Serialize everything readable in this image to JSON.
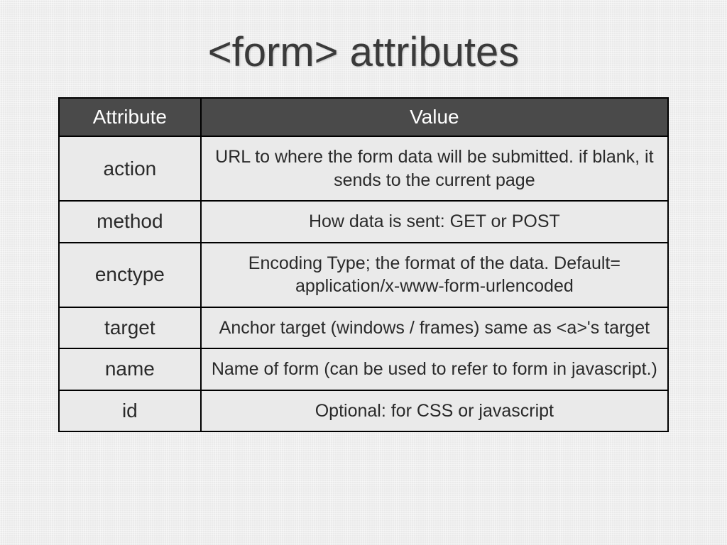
{
  "title": "<form> attributes",
  "chart_data": {
    "type": "table",
    "columns": [
      "Attribute",
      "Value"
    ],
    "rows": [
      {
        "attr": "action",
        "value": "URL to where the form data will be submitted. if blank, it sends to the current page"
      },
      {
        "attr": "method",
        "value": "How data is sent: GET or POST"
      },
      {
        "attr": "enctype",
        "value": "Encoding Type; the format of the data. Default= application/x-www-form-urlencoded"
      },
      {
        "attr": "target",
        "value": "Anchor target (windows / frames) same as <a>'s target"
      },
      {
        "attr": "name",
        "value": "Name of form (can be used to refer to form in javascript.)"
      },
      {
        "attr": "id",
        "value": "Optional: for CSS or javascript"
      }
    ]
  }
}
